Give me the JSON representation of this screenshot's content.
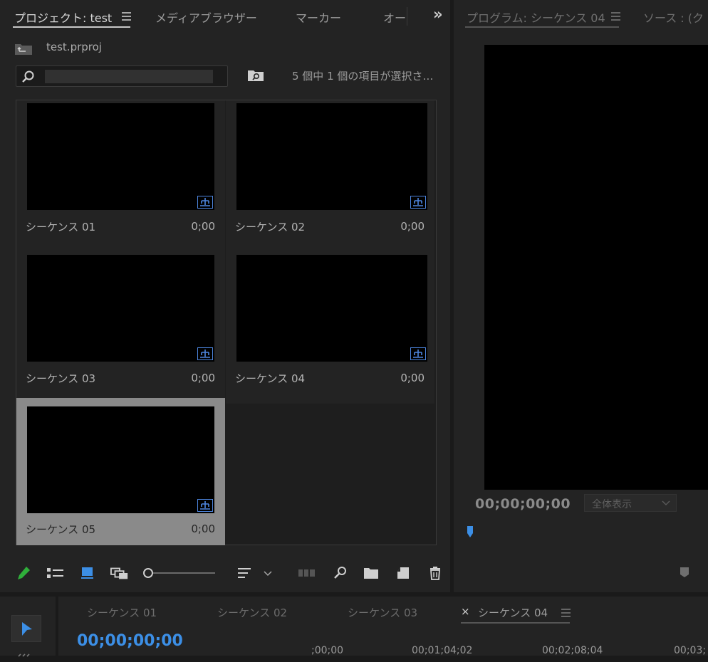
{
  "project_panel": {
    "tabs": [
      "プロジェクト: test",
      "メディアブラウザー",
      "マーカー",
      "オー"
    ],
    "overflow_label": "»",
    "file_name": "test.prproj",
    "search_value": "",
    "selection_status": "5 個中 1 個の項目が選択さ…",
    "items": [
      {
        "name": "シーケンス 01",
        "duration": "0;00",
        "selected": false
      },
      {
        "name": "シーケンス 02",
        "duration": "0;00",
        "selected": false
      },
      {
        "name": "シーケンス 03",
        "duration": "0;00",
        "selected": false
      },
      {
        "name": "シーケンス 04",
        "duration": "0;00",
        "selected": false
      },
      {
        "name": "シーケンス 05",
        "duration": "0;00",
        "selected": true
      }
    ],
    "toolbar_icons": [
      "pencil-icon",
      "list-view-icon",
      "icon-view-icon",
      "freeform-view-icon",
      "zoom-slider",
      "sort-icon",
      "automate-icon",
      "find-icon",
      "new-bin-icon",
      "new-item-icon",
      "trash-icon"
    ]
  },
  "program_monitor": {
    "tabs": [
      "プログラム: シーケンス 04",
      "ソース : (ク"
    ],
    "timecode": "00;00;00;00",
    "zoom_value": "全体表示"
  },
  "timeline": {
    "tabs": [
      "シーケンス 01",
      "シーケンス 02",
      "シーケンス 03",
      "シーケンス 04"
    ],
    "close_glyph": "×",
    "timecode": "00;00;00;00",
    "ruler": [
      ";00;00",
      "00;01;04;02",
      "00;02;08;04",
      "00;03;"
    ]
  },
  "colors": {
    "accent": "#3c8fe6",
    "sequence_badge": "#4d86e0",
    "pencil": "#2fae3a",
    "selected_item": "#8a8a8a"
  }
}
